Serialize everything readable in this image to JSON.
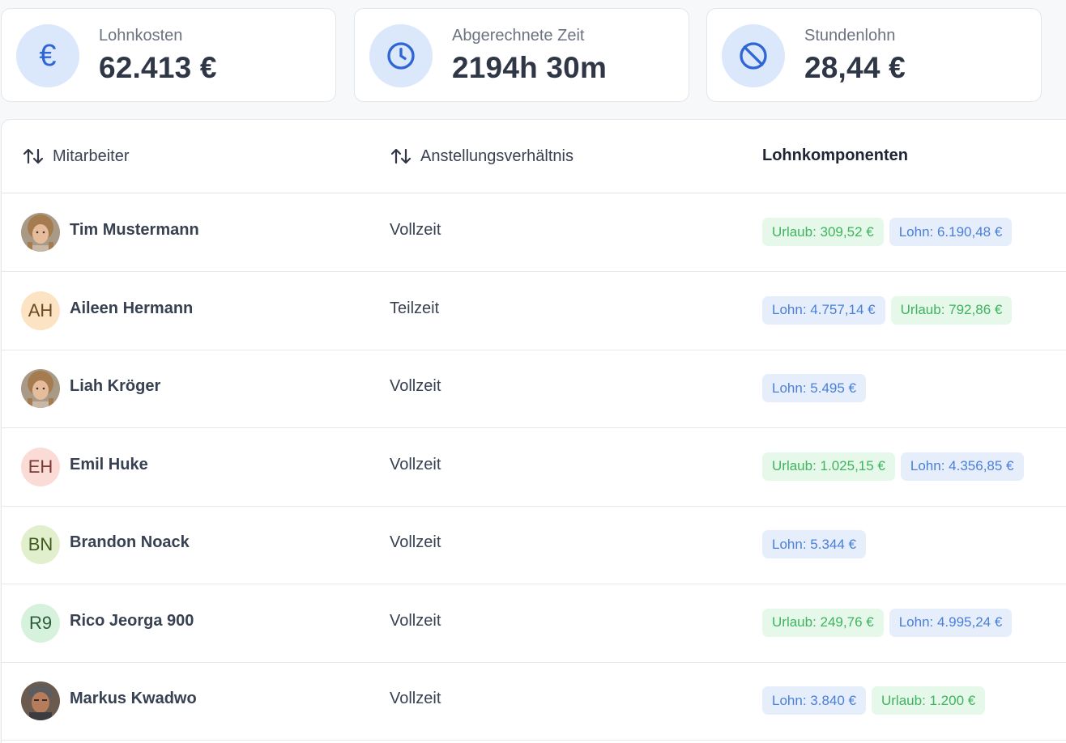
{
  "stats": [
    {
      "icon": "euro-icon",
      "glyph": "€",
      "label": "Lohnkosten",
      "value": "62.413 €"
    },
    {
      "icon": "clock-icon",
      "label": "Abgerechnete Zeit",
      "value": "2194h 30m"
    },
    {
      "icon": "no-money-icon",
      "label": "Stundenlohn",
      "value": "28,44 €"
    }
  ],
  "table": {
    "columns": [
      {
        "label": "Mitarbeiter",
        "sortable": true
      },
      {
        "label": "Anstellungsverhältnis",
        "sortable": true
      },
      {
        "label": "Lohnkomponenten",
        "sortable": false
      }
    ],
    "rows": [
      {
        "name": "Tim Mustermann",
        "avatar": {
          "type": "photo",
          "initials": ""
        },
        "type": "Vollzeit",
        "components": [
          {
            "text": "Urlaub: 309,52 €",
            "kind": "green"
          },
          {
            "text": "Lohn: 6.190,48 €",
            "kind": "blue"
          }
        ]
      },
      {
        "name": "Aileen Hermann",
        "avatar": {
          "type": "initials",
          "initials": "AH",
          "bg": "#fbe3c4",
          "fg": "#6b4a1f"
        },
        "type": "Teilzeit",
        "components": [
          {
            "text": "Lohn: 4.757,14 €",
            "kind": "blue"
          },
          {
            "text": "Urlaub: 792,86 €",
            "kind": "green"
          }
        ]
      },
      {
        "name": "Liah Kröger",
        "avatar": {
          "type": "photo",
          "initials": ""
        },
        "type": "Vollzeit",
        "components": [
          {
            "text": "Lohn: 5.495 €",
            "kind": "blue"
          }
        ]
      },
      {
        "name": "Emil Huke",
        "avatar": {
          "type": "initials",
          "initials": "EH",
          "bg": "#fadbd6",
          "fg": "#7a3a33"
        },
        "type": "Vollzeit",
        "components": [
          {
            "text": "Urlaub: 1.025,15 €",
            "kind": "green"
          },
          {
            "text": "Lohn: 4.356,85 €",
            "kind": "blue"
          }
        ]
      },
      {
        "name": "Brandon Noack",
        "avatar": {
          "type": "initials",
          "initials": "BN",
          "bg": "#e2efcc",
          "fg": "#3f5a1f"
        },
        "type": "Vollzeit",
        "components": [
          {
            "text": "Lohn: 5.344 €",
            "kind": "blue"
          }
        ]
      },
      {
        "name": "Rico Jeorga 900",
        "avatar": {
          "type": "initials",
          "initials": "R9",
          "bg": "#d6f1dc",
          "fg": "#2c5c39"
        },
        "type": "Vollzeit",
        "components": [
          {
            "text": "Urlaub: 249,76 €",
            "kind": "green"
          },
          {
            "text": "Lohn: 4.995,24 €",
            "kind": "blue"
          }
        ]
      },
      {
        "name": "Markus Kwadwo",
        "avatar": {
          "type": "photo-dark",
          "initials": ""
        },
        "type": "Vollzeit",
        "components": [
          {
            "text": "Lohn: 3.840 €",
            "kind": "blue"
          },
          {
            "text": "Urlaub: 1.200 €",
            "kind": "green"
          }
        ]
      }
    ]
  }
}
